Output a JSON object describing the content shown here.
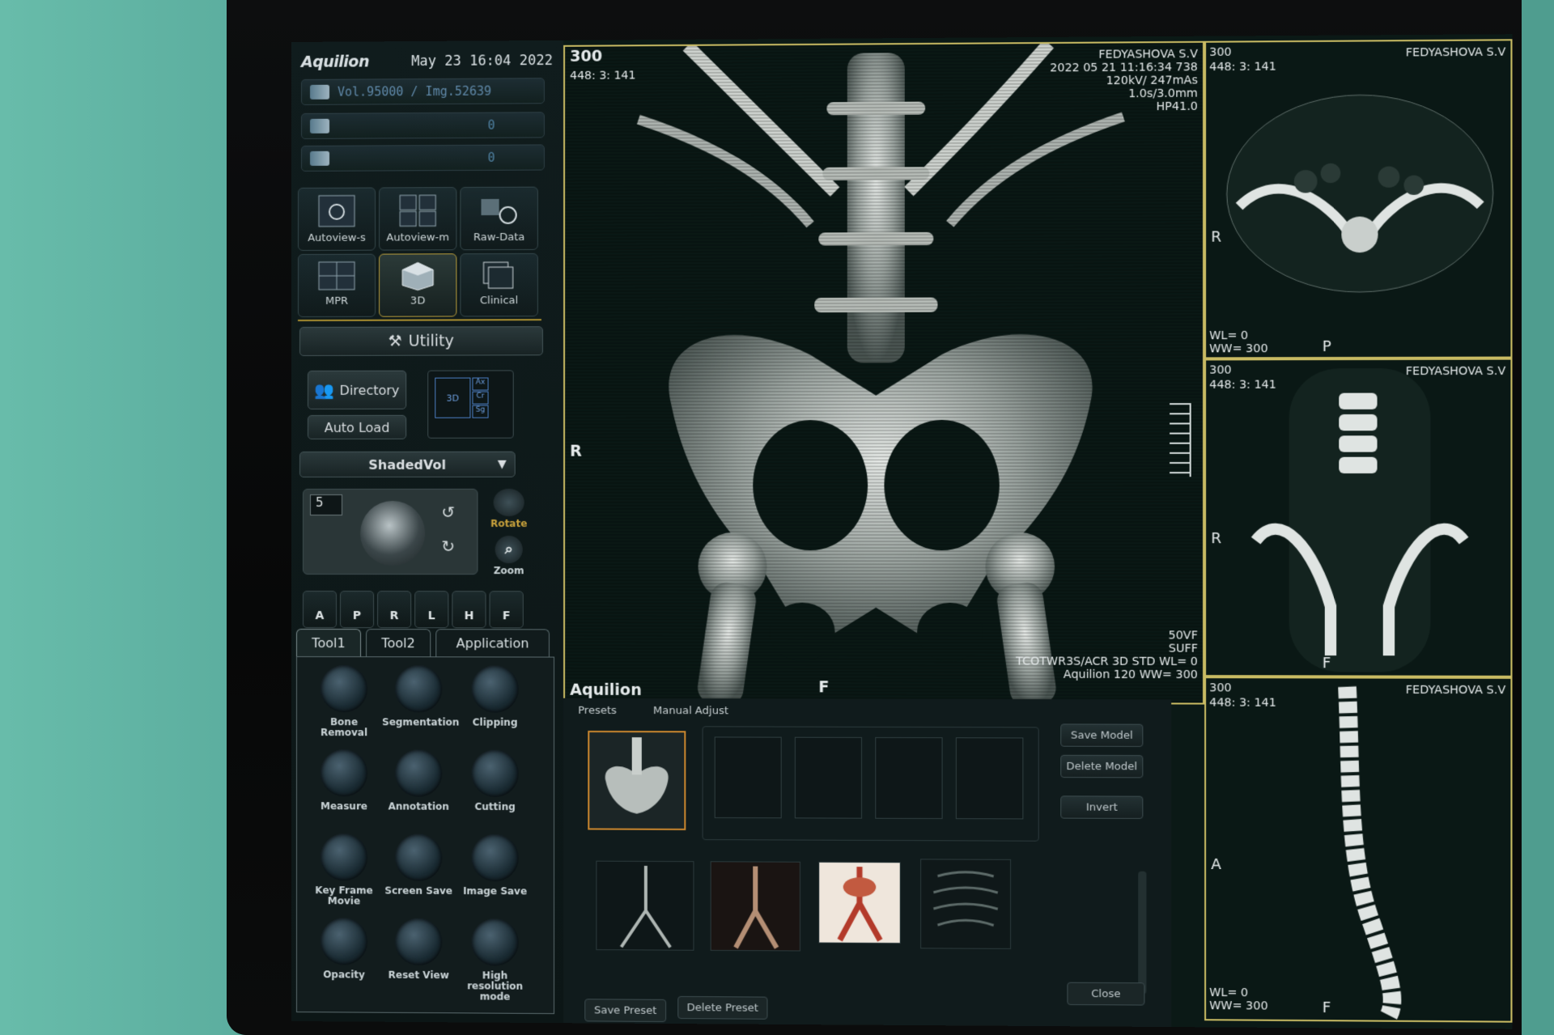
{
  "header": {
    "logo": "Aquilion",
    "datetime": "May 23 16:04 2022"
  },
  "status": {
    "volume": "Vol.95000  / Img.52639",
    "print_queue": "0",
    "archive_queue": "0"
  },
  "mode_tiles": [
    {
      "label": "Autoview-s"
    },
    {
      "label": "Autoview-m"
    },
    {
      "label": "Raw-Data"
    }
  ],
  "view_tiles": [
    {
      "label": "MPR"
    },
    {
      "label": "3D"
    },
    {
      "label": "Clinical"
    }
  ],
  "utility": {
    "label": "Utility"
  },
  "directory": {
    "label": "Directory"
  },
  "autoload": {
    "label": "Auto Load"
  },
  "layout": {
    "cells": [
      "3D",
      "Ax",
      "Cr",
      "Sg"
    ]
  },
  "render_mode": {
    "selected": "ShadedVol"
  },
  "rotate": {
    "step": "5",
    "rotate_label": "Rotate",
    "zoom_label": "Zoom"
  },
  "orient": [
    "A",
    "P",
    "R",
    "L",
    "H",
    "F"
  ],
  "tabs": [
    "Tool1",
    "Tool2",
    "Application"
  ],
  "tools": [
    {
      "label": "Bone Removal"
    },
    {
      "label": "Segmentation"
    },
    {
      "label": "Clipping"
    },
    {
      "label": "Measure"
    },
    {
      "label": "Annotation"
    },
    {
      "label": "Cutting"
    },
    {
      "label": "Key Frame Movie"
    },
    {
      "label": "Screen Save"
    },
    {
      "label": "Image Save"
    },
    {
      "label": "Opacity"
    },
    {
      "label": "Reset View"
    },
    {
      "label": "High resolution mode"
    }
  ],
  "main_view": {
    "tl1": "300",
    "tl2": "448: 3: 141",
    "tr1": "FEDYASHOVA S.V",
    "tr2": "2022 05 21 11:16:34 738",
    "tr3": "120kV/ 247mAs",
    "tr4": "1.0s/3.0mm",
    "tr5": "HP41.0",
    "left": "R",
    "bottom": "F",
    "brand": "Aquilion",
    "br1": "50VF",
    "br2": "SUFF",
    "br3": "TCOTWR3S/ACR 3D STD WL= 0",
    "br4": "Aquilion 120 WW= 300"
  },
  "axial": {
    "tl1": "300",
    "tl2": "448: 3: 141",
    "tr": "FEDYASHOVA S.V",
    "left": "R",
    "bottom": "P",
    "wl": "WL= 0",
    "ww": "WW= 300"
  },
  "coronal": {
    "tl1": "300",
    "tl2": "448: 3: 141",
    "tr": "FEDYASHOVA S.V",
    "left": "R",
    "bottom": "F"
  },
  "sagittal": {
    "tl1": "300",
    "tl2": "448: 3: 141",
    "tr": "FEDYASHOVA S.V",
    "left": "A",
    "bottom": "F",
    "wl": "WL= 0",
    "ww": "WW= 300"
  },
  "presets": {
    "tab_presets": "Presets",
    "tab_manual": "Manual Adjust",
    "save_model": "Save Model",
    "delete_model": "Delete Model",
    "invert": "Invert",
    "save_preset": "Save Preset",
    "delete_preset": "Delete Preset",
    "close": "Close"
  }
}
